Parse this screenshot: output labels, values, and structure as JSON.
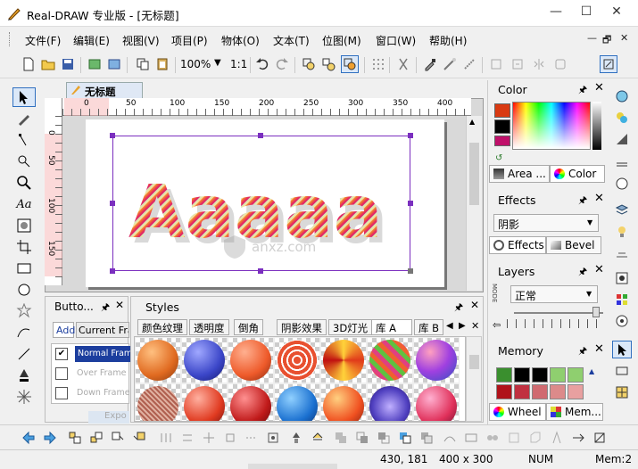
{
  "app": {
    "title": "Real-DRAW 专业版 - [无标题]"
  },
  "window_controls": {
    "minimize": "—",
    "maximize": "☐",
    "close": "✕"
  },
  "mdi_controls": {
    "minimize": "—",
    "restore": "🗗",
    "close": "✕"
  },
  "menu": [
    "文件(F)",
    "编辑(E)",
    "视图(V)",
    "项目(P)",
    "物体(O)",
    "文本(T)",
    "位图(M)",
    "窗口(W)",
    "帮助(H)"
  ],
  "toolbar": {
    "zoom": "100%",
    "ratio": "1:1"
  },
  "document": {
    "tab": "无标题"
  },
  "ruler": {
    "h_labels": [
      "0",
      "50",
      "100",
      "150",
      "200",
      "250",
      "300",
      "350",
      "400"
    ],
    "v_labels": [
      "0",
      "50",
      "100",
      "150"
    ]
  },
  "canvas": {
    "artwork_text": "Aaaaa"
  },
  "watermark": {
    "text": "anxz.com"
  },
  "buttons_panel": {
    "title": "Butto...",
    "add": "Add",
    "current_frame": "Current Fra",
    "frames": [
      "Normal Fram",
      "Over Frame",
      "Down Frame"
    ],
    "export": "Expo"
  },
  "styles_panel": {
    "title": "Styles",
    "tabs": [
      "颜色纹理",
      "透明度",
      "倒角",
      "阴影效果",
      "3D灯光",
      "库 A",
      "库 B"
    ]
  },
  "color_panel": {
    "title": "Color",
    "tab_area": "Area ...",
    "tab_color": "Color",
    "swatches": [
      "#d93a12",
      "#000000",
      "#c0106a"
    ]
  },
  "effects_panel": {
    "title": "Effects",
    "select": "阴影",
    "tab_effects": "Effects",
    "tab_bevel": "Bevel"
  },
  "layers_panel": {
    "title": "Layers",
    "mode_label": "MODE",
    "select": "正常"
  },
  "memory_panel": {
    "title": "Memory",
    "tab_wheel": "Wheel",
    "tab_mem": "Mem...",
    "colors": [
      "#3a8f2e",
      "#000000",
      "#000000",
      "#8fcf6f",
      "#8fcf6f",
      "#b0121a",
      "#c03040",
      "#d06a70",
      "#dc8a8a",
      "#e8a0a0"
    ]
  },
  "status": {
    "coords": "430, 181",
    "size": "400 x 300",
    "num": "NUM",
    "mem": "Mem:2"
  },
  "colors": {
    "accent": "#1c3e9e",
    "selection": "#7b2fbf",
    "ruler_pink": "#f8b3b3"
  }
}
